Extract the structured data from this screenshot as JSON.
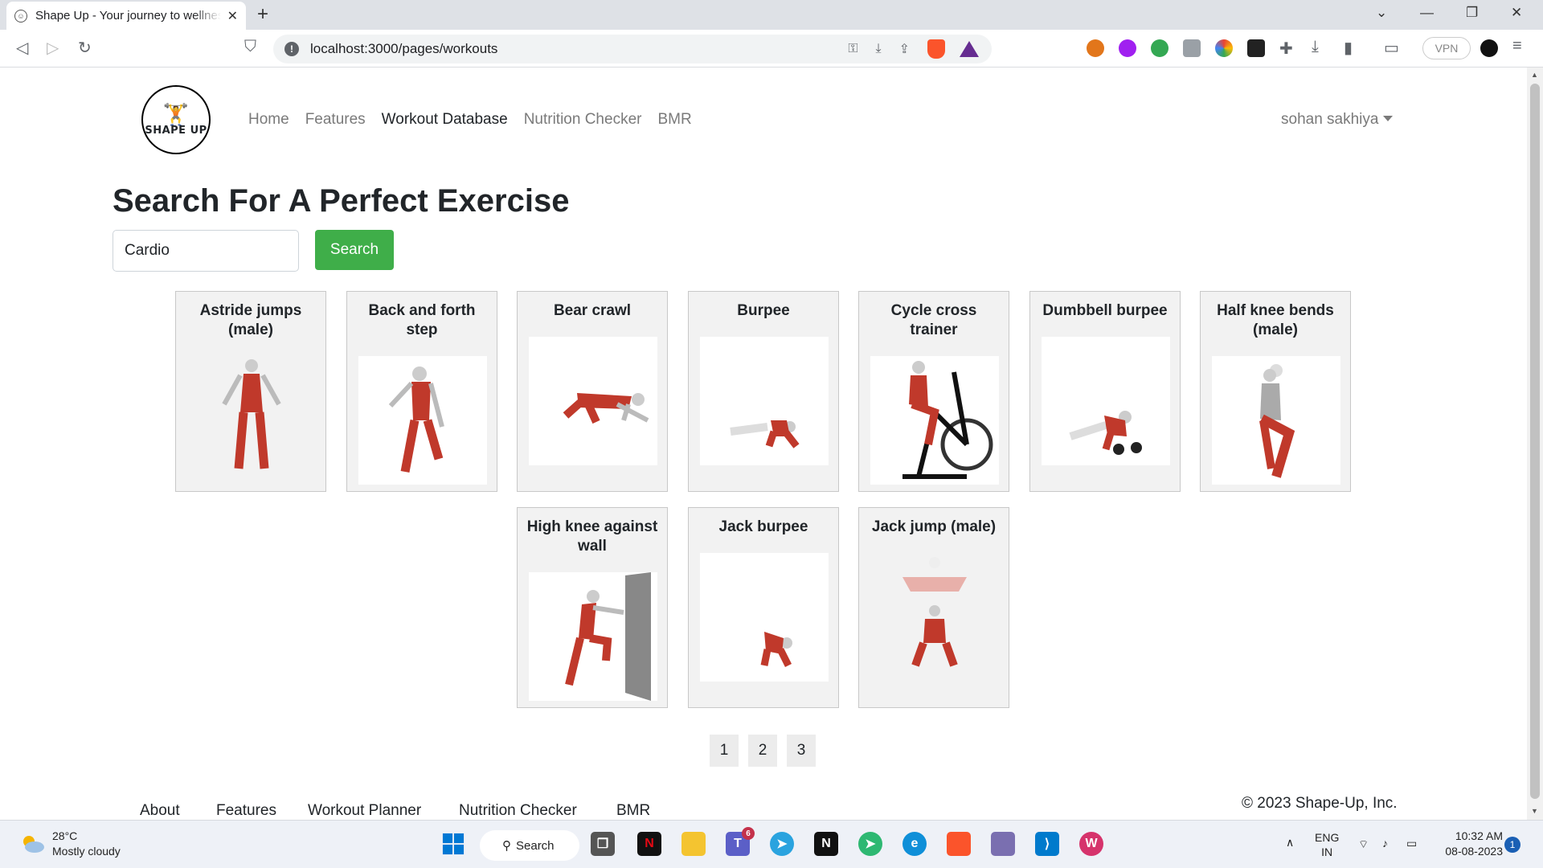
{
  "browser": {
    "tab_title": "Shape Up - Your journey to wellness",
    "url": "localhost:3000/pages/workouts",
    "vpn_label": "VPN"
  },
  "site": {
    "logo_text": "SHAPE UP",
    "nav": [
      "Home",
      "Features",
      "Workout Database",
      "Nutrition Checker",
      "BMR"
    ],
    "active_nav": "Workout Database",
    "user": "sohan sakhiya"
  },
  "main": {
    "heading": "Search For A Perfect Exercise",
    "search_value": "Cardio",
    "search_button": "Search",
    "exercises": [
      {
        "name": "Astride jumps (male)"
      },
      {
        "name": "Back and forth step"
      },
      {
        "name": "Bear crawl"
      },
      {
        "name": "Burpee"
      },
      {
        "name": "Cycle cross trainer"
      },
      {
        "name": "Dumbbell burpee"
      },
      {
        "name": "Half knee bends (male)"
      },
      {
        "name": "High knee against wall"
      },
      {
        "name": "Jack burpee"
      },
      {
        "name": "Jack jump (male)"
      }
    ],
    "pages": [
      "1",
      "2",
      "3"
    ]
  },
  "footer": {
    "links": [
      "About",
      "Features",
      "Workout Planner",
      "Nutrition Checker",
      "BMR"
    ],
    "copyright": "© 2023 Shape-Up, Inc."
  },
  "taskbar": {
    "temperature": "28°C",
    "weather": "Mostly cloudy",
    "search_label": "Search",
    "language": "ENG",
    "region": "IN",
    "time": "10:32 AM",
    "date": "08-08-2023",
    "notifications": "1",
    "teams_badge": "6"
  },
  "colors": {
    "accent_green": "#3fae49",
    "muscle_red": "#c0392b"
  }
}
